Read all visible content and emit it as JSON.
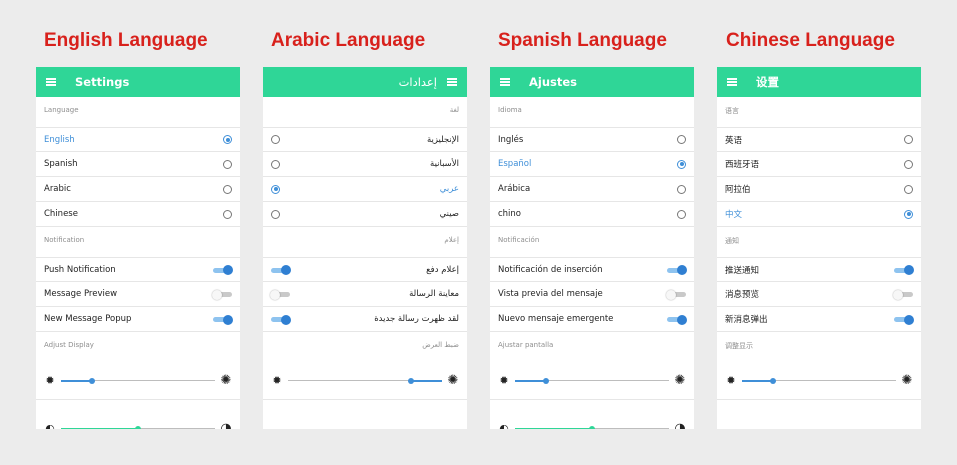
{
  "colors": {
    "appbar": "#2fd697",
    "accent_blue": "#3f8fd8",
    "toggle_on": "#2f7fd2",
    "contrast_green": "#2fd697",
    "title_red": "#d8211c"
  },
  "icons": {
    "menu": "hamburger-menu-icon",
    "brightness": "sun-icon",
    "contrast": "contrast-icon"
  },
  "columns": [
    {
      "heading": "English Language",
      "rtl": false,
      "appbar_title": "Settings",
      "language_label": "Language",
      "languages": [
        {
          "label": "English",
          "selected": true
        },
        {
          "label": "Spanish",
          "selected": false
        },
        {
          "label": "Arabic",
          "selected": false
        },
        {
          "label": "Chinese",
          "selected": false
        }
      ],
      "notification_label": "Notification",
      "notifications": [
        {
          "label": "Push Notification",
          "on": true
        },
        {
          "label": "Message Preview",
          "on": false
        },
        {
          "label": "New Message Popup",
          "on": true
        }
      ],
      "display_label": "Adjust Display",
      "sliders": [
        {
          "kind": "brightness",
          "value": 0.2
        },
        {
          "kind": "contrast",
          "value": 0.5
        }
      ]
    },
    {
      "heading": "Arabic Language",
      "rtl": true,
      "appbar_title": "إعدادات",
      "language_label": "لغة",
      "languages": [
        {
          "label": "الإنجليزية",
          "selected": false
        },
        {
          "label": "الأسبانية",
          "selected": false
        },
        {
          "label": "عربي",
          "selected": true
        },
        {
          "label": "صيني",
          "selected": false
        }
      ],
      "notification_label": "إعلام",
      "notifications": [
        {
          "label": "إعلام دفع",
          "on": true
        },
        {
          "label": "معاينة الرسالة",
          "on": false
        },
        {
          "label": "لقد ظهرت رسالة جديدة",
          "on": true
        }
      ],
      "display_label": "ضبط العرض",
      "sliders": [
        {
          "kind": "brightness",
          "value": 0.2
        }
      ]
    },
    {
      "heading": "Spanish Language",
      "rtl": false,
      "appbar_title": "Ajustes",
      "language_label": "Idioma",
      "languages": [
        {
          "label": "Inglés",
          "selected": false
        },
        {
          "label": "Español",
          "selected": true
        },
        {
          "label": "Arábica",
          "selected": false
        },
        {
          "label": "chino",
          "selected": false
        }
      ],
      "notification_label": "Notificación",
      "notifications": [
        {
          "label": "Notificación de inserción",
          "on": true
        },
        {
          "label": "Vista previa del mensaje",
          "on": false
        },
        {
          "label": "Nuevo mensaje emergente",
          "on": true
        }
      ],
      "display_label": "Ajustar pantalla",
      "sliders": [
        {
          "kind": "brightness",
          "value": 0.2
        },
        {
          "kind": "contrast",
          "value": 0.5
        }
      ]
    },
    {
      "heading": "Chinese Language",
      "rtl": false,
      "appbar_title": "设置",
      "language_label": "语言",
      "languages": [
        {
          "label": "英语",
          "selected": false
        },
        {
          "label": "西班牙语",
          "selected": false
        },
        {
          "label": "阿拉伯",
          "selected": false
        },
        {
          "label": "中文",
          "selected": true
        }
      ],
      "notification_label": "通知",
      "notifications": [
        {
          "label": "推送通知",
          "on": true
        },
        {
          "label": "消息预览",
          "on": false
        },
        {
          "label": "新消息弹出",
          "on": true
        }
      ],
      "display_label": "调整显示",
      "sliders": [
        {
          "kind": "brightness",
          "value": 0.2
        }
      ]
    }
  ]
}
